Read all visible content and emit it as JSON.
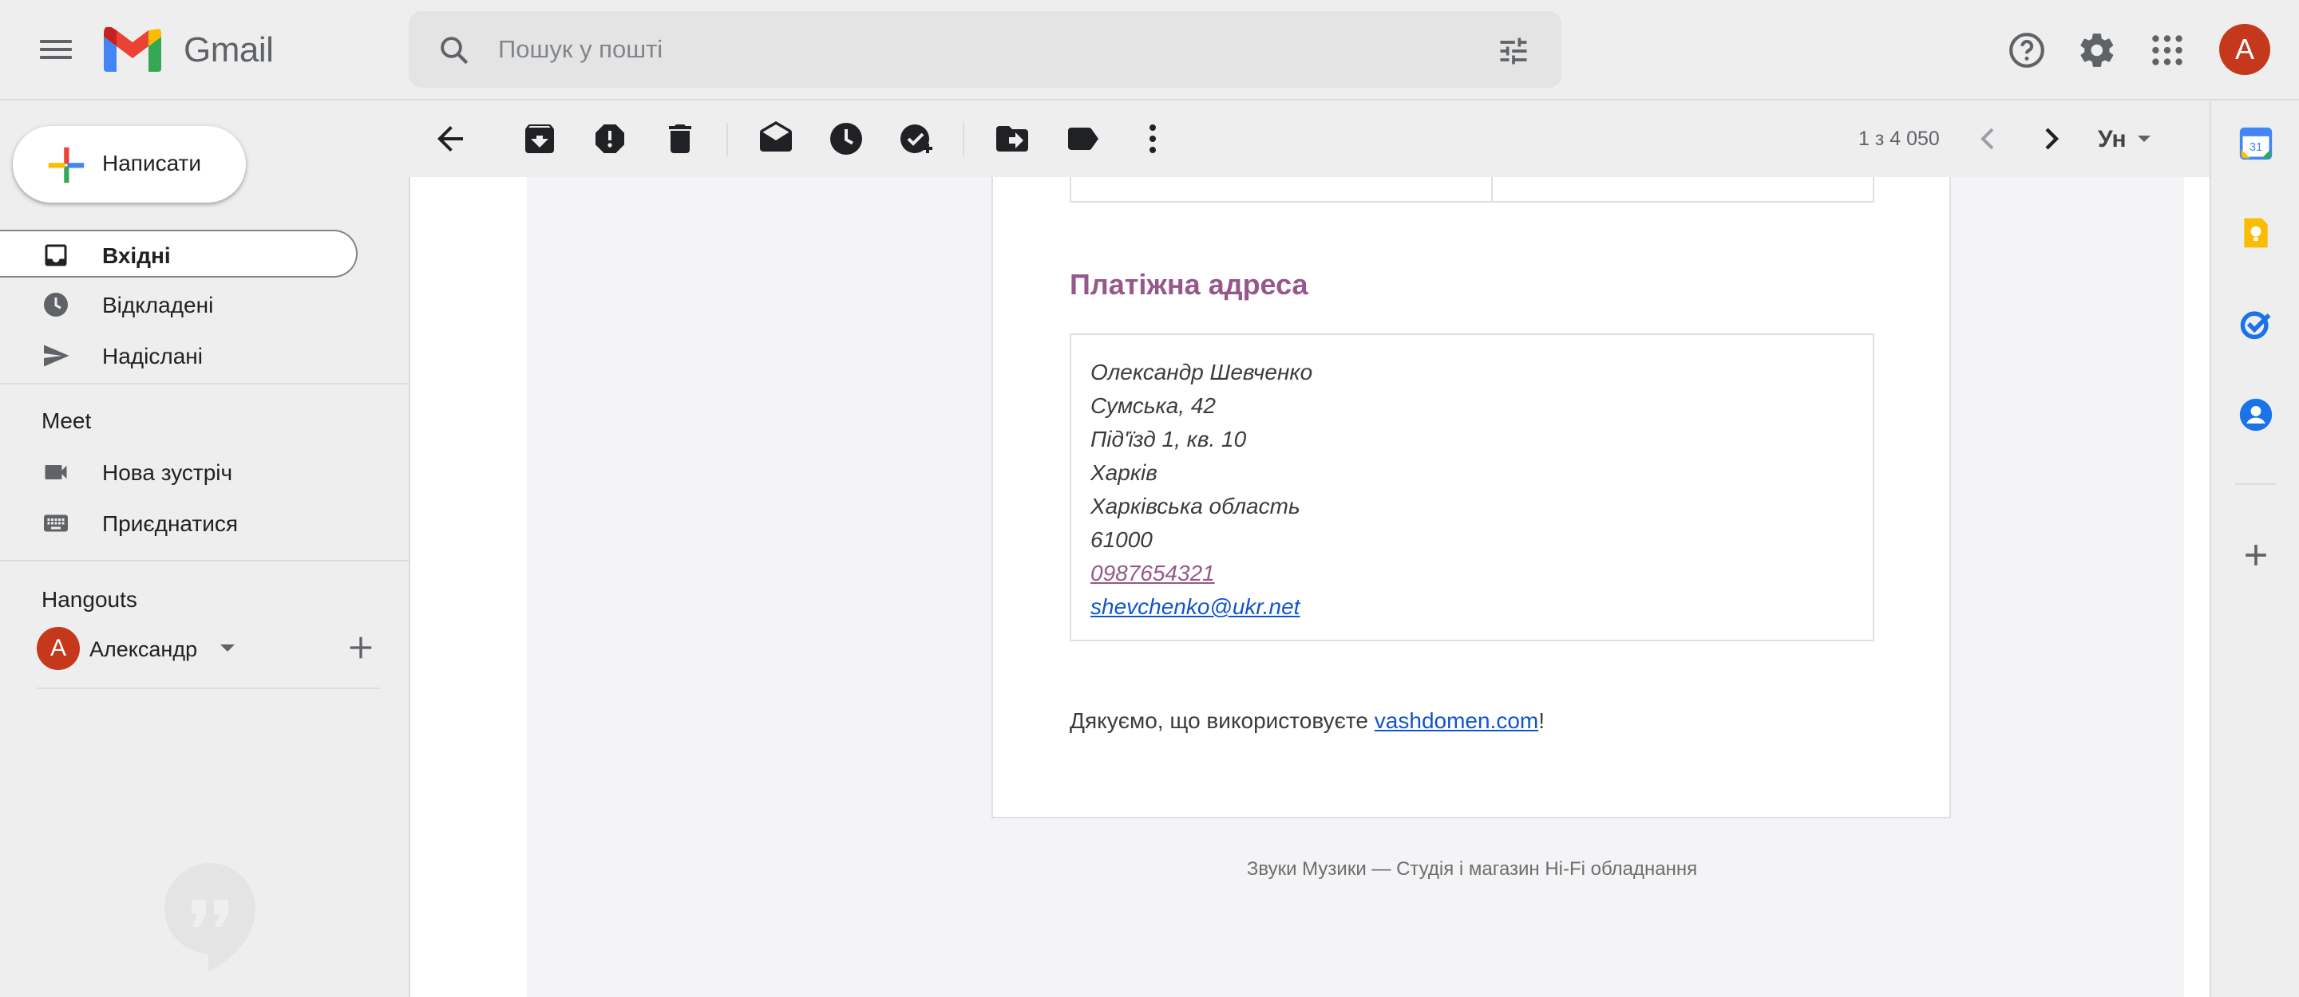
{
  "header": {
    "app_name": "Gmail",
    "search_placeholder": "Пошук у пошті",
    "avatar_letter": "A"
  },
  "nav": {
    "compose_label": "Написати",
    "items": [
      {
        "label": "Вхідні",
        "icon": "inbox-icon",
        "active": true
      },
      {
        "label": "Відкладені",
        "icon": "clock-icon"
      },
      {
        "label": "Надіслані",
        "icon": "send-icon"
      }
    ],
    "meet": {
      "title": "Meet",
      "items": [
        {
          "label": "Нова зустріч",
          "icon": "video-icon"
        },
        {
          "label": "Приєднатися",
          "icon": "keyboard-icon"
        }
      ]
    },
    "hangouts": {
      "title": "Hangouts",
      "user_letter": "A",
      "user_name": "Александр"
    }
  },
  "toolbar": {
    "pager_text": "1 з 4 050",
    "language_label": "Ун"
  },
  "message": {
    "billing_title": "Платіжна адреса",
    "address_lines": [
      "Олександр Шевченко",
      "Сумська, 42",
      "Під'їзд 1, кв. 10",
      "Харків",
      "Харківська область",
      "61000"
    ],
    "phone": "0987654321",
    "email": "shevchenko@ukr.net",
    "thanks_prefix": "Дякуємо, що використовуєте ",
    "thanks_link": "vashdomen.com",
    "thanks_suffix": "!",
    "footer_note": "Звуки Музики — Студія і магазин Hi-Fi обладнання"
  },
  "colors": {
    "accent_purple": "#96588a",
    "link_blue": "#1155cc",
    "avatar_red": "#c5381c"
  }
}
